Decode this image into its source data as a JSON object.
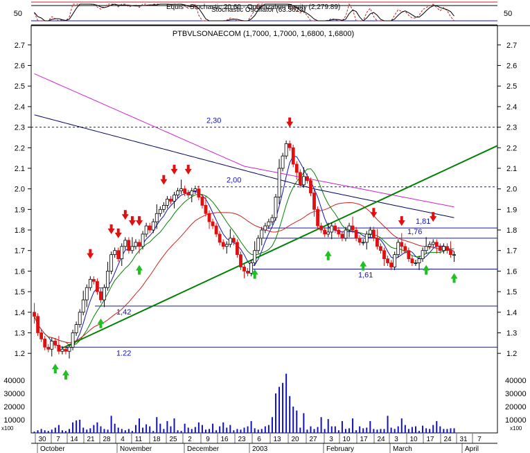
{
  "indicator_panel": {
    "title": "Equis - Stochastic 20,60 - Optimization Equity (2,279.89)",
    "subtitle": "Stochastic Oscillator (63.3623)",
    "tick_label": "50"
  },
  "chart_data": {
    "type": "candlestick",
    "title": "PTBVLSONAECOM (1,7000, 1,7000, 1,6800, 1,6800)",
    "price_axis": {
      "ylim": [
        1.15,
        2.75
      ],
      "ticks": [
        "1.2",
        "1.3",
        "1.4",
        "1.5",
        "1.6",
        "1.7",
        "1.8",
        "1.9",
        "2.0",
        "2.1",
        "2.2",
        "2.3",
        "2.4",
        "2.5",
        "2.6",
        "2.7"
      ]
    },
    "volume_axis": {
      "ylim": [
        0,
        50000
      ],
      "ticks": [
        "10000",
        "20000",
        "30000",
        "40000"
      ],
      "unit_label": "x100"
    },
    "x_axis": {
      "day_ticks": [
        "30",
        "7",
        "14",
        "21",
        "28",
        "4",
        "11",
        "18",
        "25",
        "2",
        "9",
        "16",
        "23",
        "6",
        "13",
        "20",
        "27",
        "3",
        "10",
        "17",
        "24",
        "3",
        "10",
        "17",
        "24",
        "31",
        "7"
      ],
      "months": [
        "October",
        "November",
        "December",
        "2003",
        "February",
        "March",
        "April"
      ]
    },
    "horizontal_levels": [
      {
        "value": 2.3,
        "label": "2,30",
        "style": "dashed"
      },
      {
        "value": 2.01,
        "label": "2,00",
        "style": "dashed"
      },
      {
        "value": 1.81,
        "label": "1,81",
        "style": "solid"
      },
      {
        "value": 1.76,
        "label": "1,76",
        "style": "solid"
      },
      {
        "value": 1.61,
        "label": "1,61",
        "style": "solid"
      },
      {
        "value": 1.43,
        "label": "1,42",
        "style": "solid"
      },
      {
        "value": 1.23,
        "label": "1.22",
        "style": "solid"
      }
    ],
    "trendline": {
      "from": [
        0,
        1.225
      ],
      "to": [
        134,
        2.21
      ]
    },
    "closes": [
      1.38,
      1.3,
      1.27,
      1.23,
      1.22,
      1.26,
      1.24,
      1.21,
      1.22,
      1.21,
      1.23,
      1.3,
      1.34,
      1.4,
      1.46,
      1.52,
      1.56,
      1.55,
      1.5,
      1.46,
      1.52,
      1.6,
      1.68,
      1.7,
      1.66,
      1.72,
      1.75,
      1.7,
      1.72,
      1.74,
      1.72,
      1.78,
      1.82,
      1.8,
      1.84,
      1.88,
      1.9,
      1.92,
      1.95,
      1.94,
      1.97,
      1.99,
      2.0,
      1.98,
      1.97,
      1.99,
      2.0,
      1.96,
      1.92,
      1.88,
      1.84,
      1.82,
      1.78,
      1.74,
      1.72,
      1.73,
      1.76,
      1.74,
      1.68,
      1.62,
      1.6,
      1.59,
      1.64,
      1.7,
      1.76,
      1.8,
      1.82,
      1.84,
      1.86,
      1.96,
      2.1,
      2.16,
      2.22,
      2.2,
      2.12,
      2.08,
      2.02,
      2.06,
      2.04,
      1.98,
      1.9,
      1.82,
      1.8,
      1.78,
      1.79,
      1.82,
      1.8,
      1.78,
      1.76,
      1.8,
      1.82,
      1.8,
      1.76,
      1.74,
      1.74,
      1.78,
      1.8,
      1.76,
      1.72,
      1.7,
      1.66,
      1.64,
      1.62,
      1.68,
      1.74,
      1.72,
      1.7,
      1.66,
      1.64,
      1.64,
      1.66,
      1.7,
      1.72,
      1.73,
      1.74,
      1.72,
      1.7,
      1.72,
      1.7,
      1.68,
      1.68
    ],
    "volumes": [
      1000,
      2000,
      3000,
      2000,
      1500,
      2500,
      4000,
      6000,
      2000,
      1500,
      3000,
      8000,
      9500,
      10000,
      4000,
      2500,
      3500,
      6000,
      8000,
      5000,
      3000,
      2500,
      13000,
      7000,
      4000,
      3000,
      2000,
      3000,
      1500,
      6000,
      11000,
      4000,
      6500,
      5000,
      1500,
      12000,
      7000,
      3000,
      9000,
      5000,
      11000,
      2000,
      1500,
      7000,
      4000,
      3000,
      4500,
      8000,
      6000,
      2500,
      3000,
      7000,
      2000,
      5000,
      8000,
      4000,
      6000,
      2000,
      3000,
      2500,
      4000,
      5000,
      9000,
      3500,
      2500,
      3000,
      5000,
      6000,
      12000,
      30000,
      35000,
      38000,
      45000,
      28000,
      20000,
      17000,
      4000,
      15000,
      2500,
      5000,
      3000,
      4500,
      12000,
      3000,
      10500,
      5000,
      5000,
      2000,
      9000,
      3000,
      3500,
      11000,
      2000,
      5000,
      3500,
      4000,
      9000,
      3000,
      2500,
      3000,
      3000,
      13000,
      4000,
      3000,
      5000,
      11000,
      6000,
      3000,
      4500,
      5000,
      1500,
      5500,
      3500,
      3000,
      6000,
      9000,
      5000,
      3000,
      3000,
      3500,
      3500
    ]
  }
}
